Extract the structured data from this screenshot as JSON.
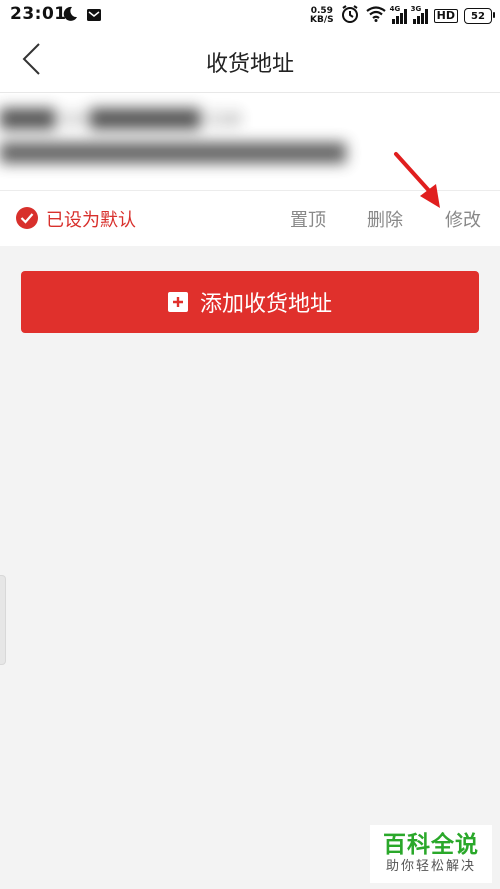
{
  "status_bar": {
    "time": "23:01",
    "net_speed_value": "0.59",
    "net_speed_unit": "KB/S",
    "signal1_label": "4G",
    "signal2_label": "3G",
    "hd_label": "HD",
    "battery": "52"
  },
  "navbar": {
    "title": "收货地址"
  },
  "address_card": {
    "blurred_line1": "████  13  ████████ 110",
    "blurred_line2": "█████████████████████████",
    "default_label": "已设为默认",
    "pin_label": "置顶",
    "delete_label": "删除",
    "edit_label": "修改"
  },
  "add_button": {
    "label": "添加收货地址"
  },
  "watermark": {
    "title": "百科全说",
    "subtitle": "助你轻松解决"
  },
  "colors": {
    "accent_red": "#e0302c",
    "watermark_green": "#2aa82a"
  }
}
